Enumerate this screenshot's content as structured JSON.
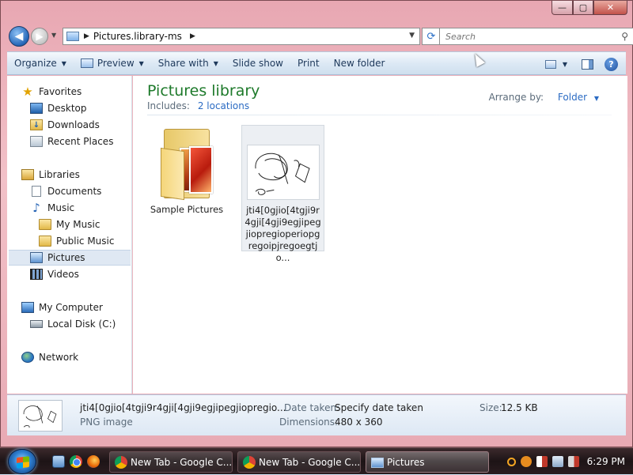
{
  "window": {
    "min_glyph": "—",
    "max_glyph": "▢",
    "close_glyph": "✕"
  },
  "address": {
    "path": [
      "Pictures.library-ms"
    ],
    "search_placeholder": "Search"
  },
  "toolbar": {
    "organize": "Organize",
    "preview": "Preview",
    "share_with": "Share with",
    "slide_show": "Slide show",
    "print": "Print",
    "new_folder": "New folder",
    "help": "?"
  },
  "nav": {
    "favorites": "Favorites",
    "desktop": "Desktop",
    "downloads": "Downloads",
    "recent_places": "Recent Places",
    "libraries": "Libraries",
    "documents": "Documents",
    "music": "Music",
    "my_music": "My Music",
    "public_music": "Public Music",
    "pictures": "Pictures",
    "videos": "Videos",
    "my_computer": "My Computer",
    "local_disk": "Local Disk (C:)",
    "network": "Network"
  },
  "content": {
    "title": "Pictures library",
    "includes_label": "Includes:",
    "includes_link": "2 locations",
    "arrange_label": "Arrange by:",
    "arrange_value": "Folder",
    "items": [
      {
        "label": "Sample Pictures"
      },
      {
        "label": "jti4[0gjio[4tgji9r4gji[4gji9egjipegjiopregioperiopgregoipjregoegtjo..."
      }
    ]
  },
  "details": {
    "name": "jti4[0gjio[4tgji9r4gji[4gji9egjipegjiopregio...",
    "type": "PNG image",
    "date_taken_label": "Date taken:",
    "date_taken_value": "Specify date taken",
    "dimensions_label": "Dimensions:",
    "dimensions_value": "480 x 360",
    "size_label": "Size:",
    "size_value": "12.5 KB"
  },
  "taskbar": {
    "tasks": [
      {
        "label": "New Tab - Google C..."
      },
      {
        "label": "New Tab - Google C..."
      },
      {
        "label": "Pictures"
      }
    ],
    "clock": "6:29 PM"
  }
}
